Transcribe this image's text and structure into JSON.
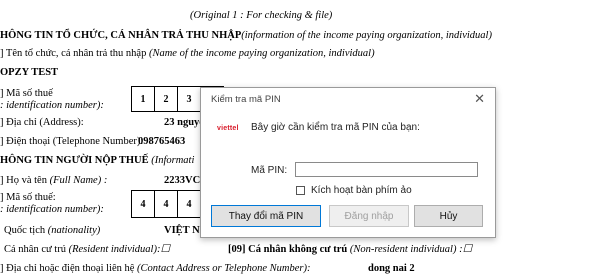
{
  "document": {
    "header_note": "(Original 1 : For checking & file)",
    "section1_title": "HÔNG TIN TỔ CHỨC, CÁ NHÂN TRẢ THU NHẬP",
    "section1_title_en": "(information of the income paying organization, individual)",
    "row_org_name_label": "] Tên tổ chức, cá nhân trả thu nhập",
    "row_org_name_label_en": "(Name of the income paying organization, individual)",
    "org_name_value": "OPZY TEST",
    "tax_code_label": "] Mã số thuế",
    "tax_code_label_en": ": identification number):",
    "tax_code_digits": [
      "1",
      "2",
      "3"
    ],
    "address_label": "] Địa chỉ (Address):",
    "address_value": "23 nguyen thi h",
    "phone_label": "] Điện thoại (Telephone Number):",
    "phone_value": "098765463",
    "section2_title": "HÔNG TIN NGƯỜI NỘP THUẾ",
    "section2_title_en": "(Informati",
    "fullname_label": "] Họ và tên",
    "fullname_label_en": "(Full Name) :",
    "fullname_value": "2233VC UEFO",
    "tax_code2_label": "] Mã số thuế:",
    "tax_code2_label_en": ": identification number):",
    "tax_code2_digits": [
      "4",
      "4",
      "4"
    ],
    "nationality_label": "Quốc tịch",
    "nationality_label_en": "(nationality)",
    "nationality_value": "VIỆT NAM",
    "resident_label": "Cá nhân cư trú",
    "resident_label_en": "(Resident individual):☐",
    "nonresident_label": "[09] Cá nhân không cư trú",
    "nonresident_label_en": "(Non-resident individual) :☐",
    "contact_label": "] Địa chỉ hoặc điện thoại liên hệ",
    "contact_label_en": "(Contact Address or Telephone Number):",
    "contact_value": "dong nai 2"
  },
  "dialog": {
    "title": "Kiểm tra mã PIN",
    "close_glyph": "✕",
    "logo_text": "viettel",
    "prompt": "Bây giờ cần kiểm tra mã PIN của bạn:",
    "pin_label": "Mã PIN:",
    "pin_value": "",
    "virtual_keyboard_label": "Kích hoạt bàn phím ảo",
    "virtual_keyboard_checked": false,
    "change_pin_button": "Thay đổi mã PIN",
    "login_button": "Đăng nhập",
    "cancel_button": "Hủy"
  }
}
